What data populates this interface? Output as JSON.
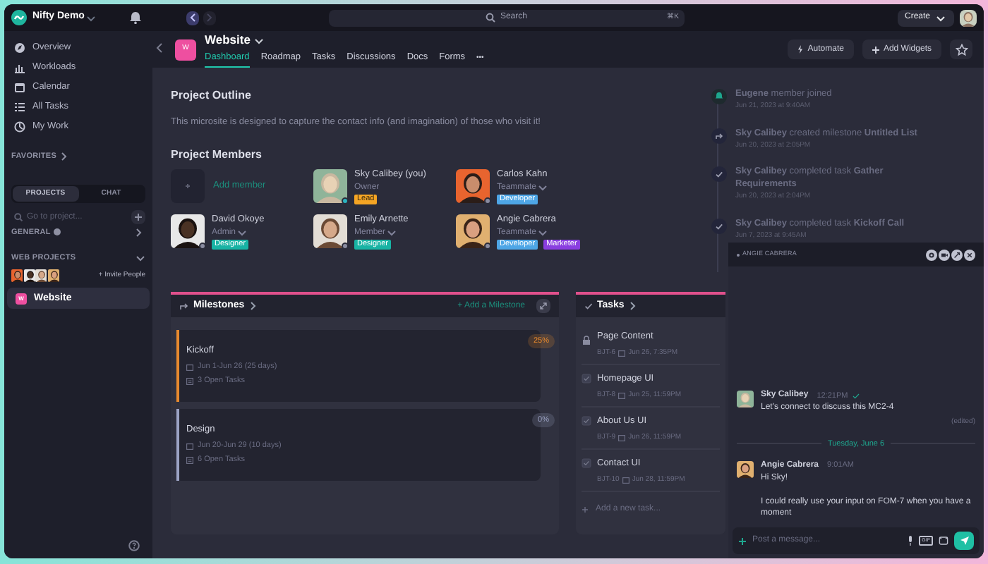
{
  "top_bar": {
    "workspace": "Nifty Demo",
    "search_placeholder": "Search",
    "shortcut": "⌘K",
    "create_button": "Create"
  },
  "sidebar": {
    "nav": [
      {
        "label": "Overview"
      },
      {
        "label": "Workloads"
      },
      {
        "label": "Calendar"
      },
      {
        "label": "All Tasks"
      },
      {
        "label": "My Work"
      }
    ],
    "favorites": "FAVORITES",
    "tabs": [
      {
        "label": "PROJECTS",
        "selected": true
      },
      {
        "label": "CHAT",
        "selected": false
      }
    ],
    "search_placeholder": "Go to project...",
    "sections": [
      {
        "label": "GENERAL",
        "expanded": false
      },
      {
        "label": "WEB PROJECTS",
        "expanded": true
      }
    ],
    "invite": "+ Invite People",
    "projects": [
      {
        "initial": "W",
        "label": "Website",
        "selected": true
      }
    ]
  },
  "project": {
    "initial": "W",
    "title": "Website",
    "tabs": [
      {
        "label": "Dashboard",
        "selected": true
      },
      {
        "label": "Roadmap",
        "selected": false
      },
      {
        "label": "Tasks",
        "selected": false
      },
      {
        "label": "Discussions",
        "selected": false
      },
      {
        "label": "Docs",
        "selected": false
      },
      {
        "label": "Forms",
        "selected": false
      }
    ],
    "more": "•••",
    "buttons": [
      {
        "kind": "automate",
        "label": "Automate"
      },
      {
        "kind": "add",
        "label": "Add Widgets"
      },
      {
        "kind": "star"
      }
    ]
  },
  "outline": {
    "title": "Project Outline",
    "description": "This microsite is designed to capture the contact info (and imagination) of those who visit it!"
  },
  "members": {
    "title": "Project Members",
    "add_label": "Add member",
    "items": [
      {
        "name": "Sky Calibey (you)",
        "role": "Owner",
        "role_menu": false,
        "online": true,
        "tags": [
          {
            "label": "Lead",
            "color": "#f5a524"
          }
        ]
      },
      {
        "name": "Carlos Kahn",
        "role": "Teammate",
        "role_menu": true,
        "online": false,
        "tags": [
          {
            "label": "Developer",
            "color": "#4ea6e6"
          }
        ]
      },
      {
        "name": "David Okoye",
        "role": "Admin",
        "role_menu": true,
        "online": false,
        "tags": [
          {
            "label": "Designer",
            "color": "#18b3a4"
          }
        ]
      },
      {
        "name": "Emily Arnette",
        "role": "Member",
        "role_menu": true,
        "online": false,
        "tags": [
          {
            "label": "Designer",
            "color": "#18b3a4"
          }
        ]
      },
      {
        "name": "Angie Cabrera",
        "role": "Teammate",
        "role_menu": true,
        "online": false,
        "tags": [
          {
            "label": "Developer",
            "color": "#4ea6e6"
          },
          {
            "label": "Marketer",
            "color": "#8a3ee0"
          }
        ]
      }
    ]
  },
  "milestones": {
    "title": "Milestones",
    "add": "+ Add a Milestone",
    "items": [
      {
        "name": "Kickoff",
        "dates": "Jun 1-Jun 26 (25 days)",
        "open_tasks": "3 Open Tasks",
        "percent": "25%",
        "color": "#e88a2e"
      },
      {
        "name": "Design",
        "dates": "Jun 20-Jun 29 (10 days)",
        "open_tasks": "6 Open Tasks",
        "percent": "0%",
        "color": "#9ca3c4"
      }
    ]
  },
  "tasks": {
    "title": "Tasks",
    "add": "Add a new task...",
    "items": [
      {
        "kind": "locked",
        "name": "Page Content",
        "id": "BJT-6",
        "due": "Jun 26, 7:35PM"
      },
      {
        "kind": "task",
        "name": "Homepage UI",
        "id": "BJT-8",
        "due": "Jun 25, 11:59PM",
        "checked": false
      },
      {
        "kind": "task",
        "name": "About Us UI",
        "id": "BJT-9",
        "due": "Jun 26, 11:59PM",
        "checked": false
      },
      {
        "kind": "task",
        "name": "Contact UI",
        "id": "BJT-10",
        "due": "Jun 28, 11:59PM",
        "checked": false
      }
    ]
  },
  "activity": [
    {
      "kind": "joined",
      "text": "**Eugene** member joined",
      "time": "Jun 21, 2023 at 9:40AM"
    },
    {
      "kind": "milestone",
      "text": "**Sky Calibey** created milestone **Untitled List**",
      "time": "Jun 20, 2023 at 2:05PM"
    },
    {
      "kind": "completed",
      "text": "**Sky Calibey** completed task **Gather Requirements**",
      "time": "Jun 20, 2023 at 2:04PM"
    },
    {
      "kind": "completed",
      "text": "**Sky Calibey** completed task **Kickoff Call**",
      "time": "Jun 7, 2023 at 9:45AM"
    }
  ],
  "chat": {
    "title": "ANGIE CABRERA",
    "messages": [
      {
        "kind": "message",
        "author": "Sky Calibey",
        "time": "12:21PM",
        "seen": true,
        "lines": [
          "Let's connect to discuss this MC2-4"
        ],
        "edited": "(edited)"
      },
      {
        "kind": "divider",
        "label": "Tuesday, June 6"
      },
      {
        "kind": "message",
        "author": "Angie Cabrera",
        "time": "9:01AM",
        "seen": false,
        "lines": [
          "Hi Sky!",
          "I could really use your input on FOM-7 when you have a moment"
        ]
      }
    ],
    "placeholder": "Post a message...",
    "gif": "GIF"
  }
}
